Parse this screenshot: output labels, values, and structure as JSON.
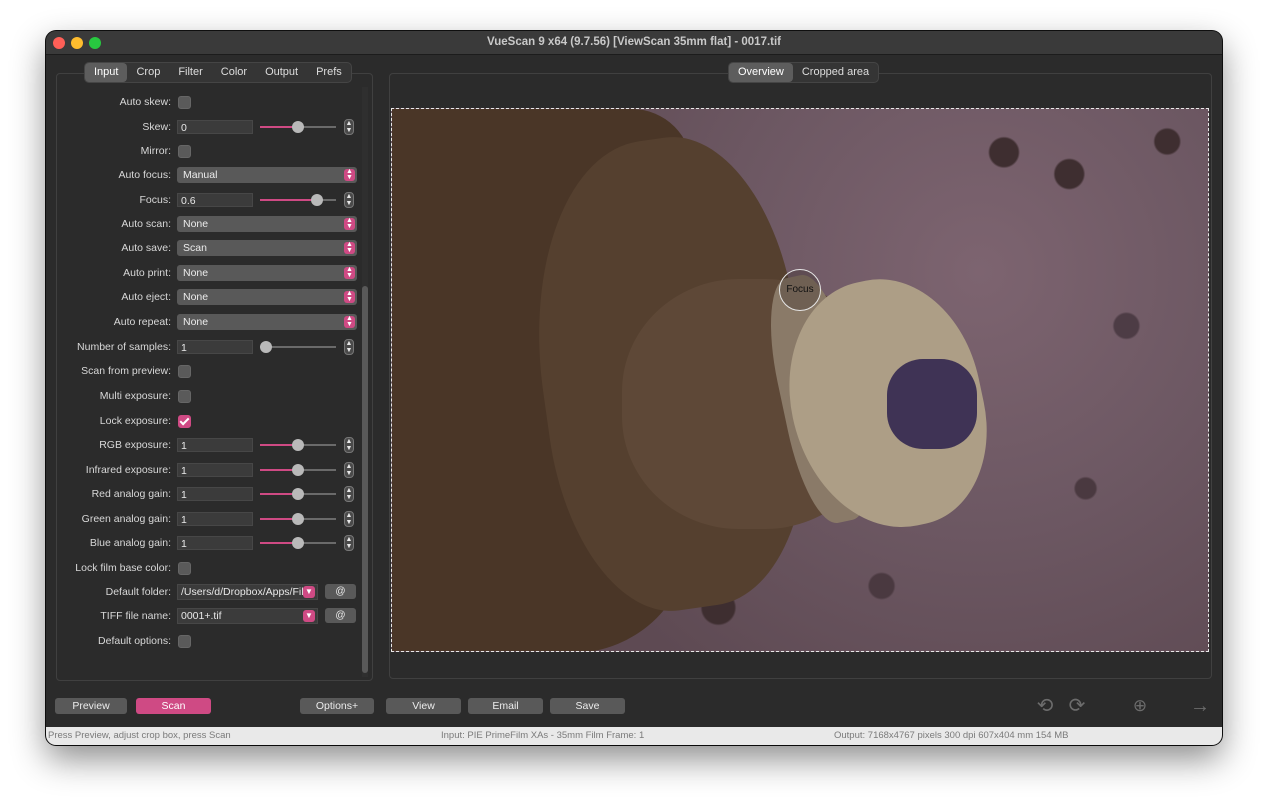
{
  "window": {
    "title": "VueScan 9 x64 (9.7.56) [ViewScan 35mm flat] - 0017.tif"
  },
  "left_tabs": [
    {
      "label": "Input",
      "active": true
    },
    {
      "label": "Crop"
    },
    {
      "label": "Filter"
    },
    {
      "label": "Color"
    },
    {
      "label": "Output"
    },
    {
      "label": "Prefs"
    }
  ],
  "settings": {
    "auto_skew": {
      "label": "Auto skew:",
      "checked": false
    },
    "skew": {
      "label": "Skew:",
      "value": "0",
      "slider": 0.5
    },
    "mirror": {
      "label": "Mirror:",
      "checked": false
    },
    "auto_focus": {
      "label": "Auto focus:",
      "value": "Manual"
    },
    "focus": {
      "label": "Focus:",
      "value": "0.6",
      "slider": 0.75
    },
    "auto_scan": {
      "label": "Auto scan:",
      "value": "None"
    },
    "auto_save": {
      "label": "Auto save:",
      "value": "Scan"
    },
    "auto_print": {
      "label": "Auto print:",
      "value": "None"
    },
    "auto_eject": {
      "label": "Auto eject:",
      "value": "None"
    },
    "auto_repeat": {
      "label": "Auto repeat:",
      "value": "None"
    },
    "num_samples": {
      "label": "Number of samples:",
      "value": "1",
      "slider": 0.0
    },
    "scan_from_preview": {
      "label": "Scan from preview:",
      "checked": false
    },
    "multi_exposure": {
      "label": "Multi exposure:",
      "checked": false
    },
    "lock_exposure": {
      "label": "Lock exposure:",
      "checked": true
    },
    "rgb_exposure": {
      "label": "RGB exposure:",
      "value": "1",
      "slider": 0.5
    },
    "ir_exposure": {
      "label": "Infrared exposure:",
      "value": "1",
      "slider": 0.5
    },
    "red_gain": {
      "label": "Red analog gain:",
      "value": "1",
      "slider": 0.5
    },
    "green_gain": {
      "label": "Green analog gain:",
      "value": "1",
      "slider": 0.5
    },
    "blue_gain": {
      "label": "Blue analog gain:",
      "value": "1",
      "slider": 0.5
    },
    "lock_film_base": {
      "label": "Lock film base color:",
      "checked": false
    },
    "default_folder": {
      "label": "Default folder:",
      "value": "/Users/d/Dropbox/Apps/Film",
      "button": "@"
    },
    "tiff_file_name": {
      "label": "TIFF file name:",
      "value": "0001+.tif",
      "button": "@"
    },
    "default_options": {
      "label": "Default options:",
      "checked": false
    }
  },
  "preview_tabs": [
    {
      "label": "Overview",
      "active": true
    },
    {
      "label": "Cropped area"
    }
  ],
  "focus_marker": "Focus",
  "buttons": {
    "preview": "Preview",
    "scan": "Scan",
    "options": "Options+",
    "view": "View",
    "email": "Email",
    "save": "Save"
  },
  "icons": {
    "rotate_left": "rotate-left-icon",
    "rotate_right": "rotate-right-icon",
    "zoom_in": "zoom-in-icon",
    "next": "arrow-right-icon"
  },
  "status": {
    "left": "Press Preview, adjust crop box, press Scan",
    "center": "Input: PIE PrimeFilm XAs - 35mm Film Frame: 1",
    "right": "Output: 7168x4767 pixels 300 dpi 607x404 mm 154 MB"
  },
  "colors": {
    "accent": "#cf4a84",
    "background": "#2b2b2b"
  }
}
